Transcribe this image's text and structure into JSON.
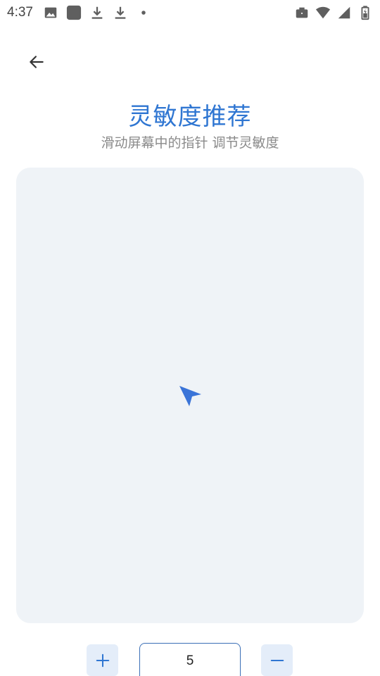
{
  "status_bar": {
    "time": "4:37",
    "left_icons": [
      "image-icon",
      "app-square-icon",
      "download-icon",
      "download-icon",
      "dot-icon"
    ],
    "right_icons": [
      "work-briefcase-icon",
      "wifi-icon",
      "cell-signal-icon",
      "battery-icon"
    ]
  },
  "header": {
    "back_icon": "arrow-back-icon"
  },
  "page": {
    "title": "灵敏度推荐",
    "subtitle": "滑动屏幕中的指针 调节灵敏度"
  },
  "touch_area": {
    "pointer_icon": "navigation-pointer-icon",
    "pointer_color": "#3a74d8",
    "background_color": "#eff3f7"
  },
  "controls": {
    "increase_icon": "plus-icon",
    "decrease_icon": "minus-icon",
    "value": "5"
  },
  "colors": {
    "accent": "#2f76d2",
    "button_bg": "#e4edf9"
  }
}
